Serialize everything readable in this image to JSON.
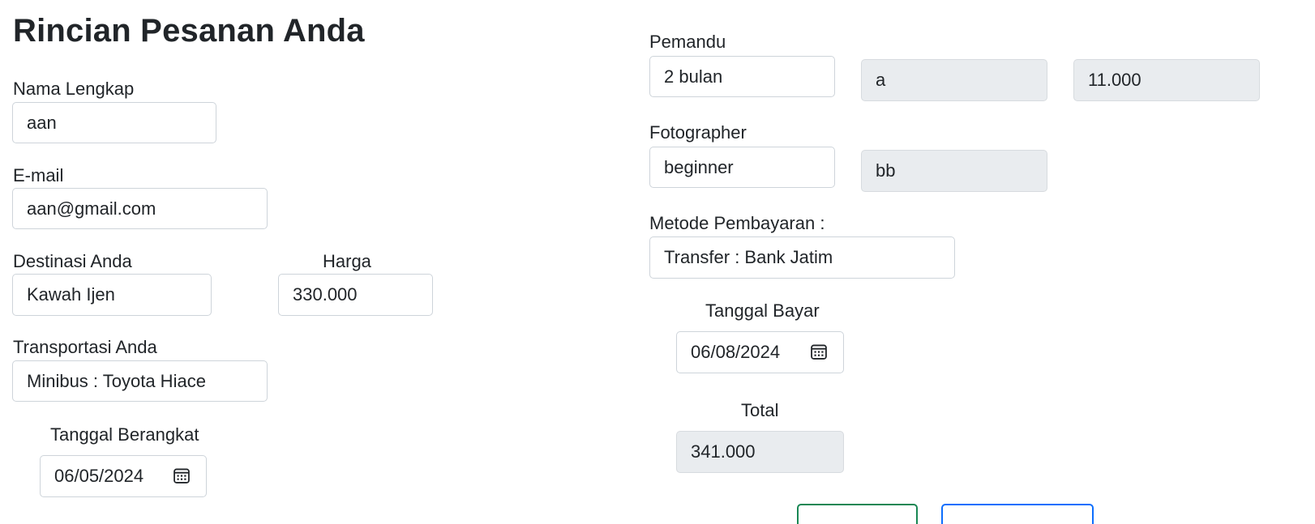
{
  "page": {
    "title": "Rincian Pesanan Anda"
  },
  "customer": {
    "name_label": "Nama Lengkap",
    "name_value": "aan",
    "email_label": "E-mail",
    "email_value": "aan@gmail.com"
  },
  "destination": {
    "label": "Destinasi Anda",
    "value": "Kawah Ijen",
    "price_label": "Harga",
    "price_value": "330.000"
  },
  "transport": {
    "label": "Transportasi Anda",
    "value": "Minibus : Toyota Hiace"
  },
  "departure": {
    "label": "Tanggal Berangkat",
    "value": "06/05/2024"
  },
  "guide": {
    "label": "Pemandu",
    "duration_value": "2 bulan",
    "name_value": "a",
    "price_value": "11.000"
  },
  "photographer": {
    "label": "Fotographer",
    "level_value": "beginner",
    "name_value": "bb"
  },
  "payment": {
    "method_label": "Metode Pembayaran :",
    "method_value": "Transfer : Bank Jatim",
    "date_label": "Tanggal Bayar",
    "date_value": "06/08/2024",
    "total_label": "Total",
    "total_value": "341.000"
  },
  "colors": {
    "primary_button_border": "#198754",
    "secondary_button_border": "#0d6efd"
  },
  "icons": {
    "date_picker": "calendar-icon"
  }
}
